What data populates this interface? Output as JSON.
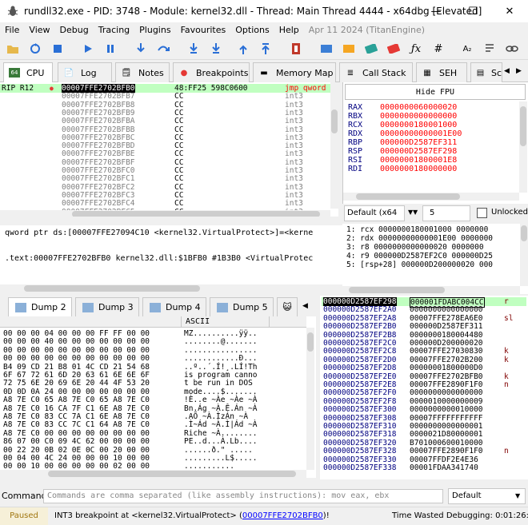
{
  "window": {
    "title": "rundll32.exe - PID: 3748 - Module: kernel32.dll - Thread: Main Thread 4444 - x64dbg [Elevated]",
    "minimize": "—",
    "maximize": "☐",
    "close": "✕"
  },
  "menu": {
    "items": [
      "File",
      "View",
      "Debug",
      "Tracing",
      "Plugins",
      "Favourites",
      "Options",
      "Help"
    ],
    "date": "Apr 11 2024 (TitanEngine)"
  },
  "tabs": [
    "CPU",
    "Log",
    "Notes",
    "Breakpoints",
    "Memory Map",
    "Call Stack",
    "SEH",
    "Sc"
  ],
  "disasm": {
    "rip_label": "RIP R12",
    "rows": [
      {
        "addr": "00007FFE2702BFB0",
        "bytes": "48:FF25 598C0600",
        "instr": "jmp qword"
      },
      {
        "addr": "00007FFE2702BFB7",
        "bytes": "CC",
        "instr": "int3"
      },
      {
        "addr": "00007FFE2702BFB8",
        "bytes": "CC",
        "instr": "int3"
      },
      {
        "addr": "00007FFE2702BFB9",
        "bytes": "CC",
        "instr": "int3"
      },
      {
        "addr": "00007FFE2702BFBA",
        "bytes": "CC",
        "instr": "int3"
      },
      {
        "addr": "00007FFE2702BFBB",
        "bytes": "CC",
        "instr": "int3"
      },
      {
        "addr": "00007FFE2702BFBC",
        "bytes": "CC",
        "instr": "int3"
      },
      {
        "addr": "00007FFE2702BFBD",
        "bytes": "CC",
        "instr": "int3"
      },
      {
        "addr": "00007FFE2702BFBE",
        "bytes": "CC",
        "instr": "int3"
      },
      {
        "addr": "00007FFE2702BFBF",
        "bytes": "CC",
        "instr": "int3"
      },
      {
        "addr": "00007FFE2702BFC0",
        "bytes": "CC",
        "instr": "int3"
      },
      {
        "addr": "00007FFE2702BFC1",
        "bytes": "CC",
        "instr": "int3"
      },
      {
        "addr": "00007FFE2702BFC2",
        "bytes": "CC",
        "instr": "int3"
      },
      {
        "addr": "00007FFE2702BFC3",
        "bytes": "CC",
        "instr": "int3"
      },
      {
        "addr": "00007FFE2702BFC4",
        "bytes": "CC",
        "instr": "int3"
      },
      {
        "addr": "00007FFE2702BFC5",
        "bytes": "CC",
        "instr": "int3"
      }
    ]
  },
  "info": {
    "line1": "qword ptr ds:[00007FFE27094C10 <kernel32.VirtualProtect>]=<kerne",
    "line2": ".text:00007FFE2702BFB0 kernel32.dll:$1BFB0 #1B3B0 <VirtualProtec"
  },
  "registers": {
    "hide_fpu": "Hide FPU",
    "rows": [
      {
        "name": "RAX",
        "value": "0000000060000020"
      },
      {
        "name": "RBX",
        "value": "0000000000000000"
      },
      {
        "name": "RCX",
        "value": "0000000180001000"
      },
      {
        "name": "RDX",
        "value": "00000000000001E00"
      },
      {
        "name": "RBP",
        "value": "000000D2587EF311"
      },
      {
        "name": "RSP",
        "value": "000000D2587EF298"
      },
      {
        "name": "RSI",
        "value": "00000001800001E8"
      },
      {
        "name": "RDI",
        "value": "0000000180000000"
      }
    ]
  },
  "callconv": {
    "convention": "Default (x64",
    "arg_count": "5",
    "unlocked": "Unlocked"
  },
  "stack_args": [
    "1: rcx 0000000180001000 0000000",
    "2: rdx 00000000000001E00 0000000",
    "3: r8 0000000000000020 0000000",
    "4: r9 000000D2587EF2C0 000000D25",
    "5: [rsp+28] 000000D200000020 000"
  ],
  "dump_tabs": [
    "Dump 2",
    "Dump 3",
    "Dump 4",
    "Dump 5"
  ],
  "dump": {
    "ascii_header": "ASCII",
    "rows": [
      {
        "hex": "00 00 00 04 00 00 00 FF FF 00 00",
        "ascii": "MZ..........ÿÿ.."
      },
      {
        "hex": "00 00 00 40 00 00 00 00 00 00 00",
        "ascii": "........@......."
      },
      {
        "hex": "00 00 00 00 00 00 00 00 00 00 00",
        "ascii": "................"
      },
      {
        "hex": "00 00 00 00 00 00 00 00 00 00 00",
        "ascii": "............Ð..."
      },
      {
        "hex": "B4 09 CD 21 B8 01 4C CD 21 54 68",
        "ascii": "..º..´.Í!¸.LÍ!Th"
      },
      {
        "hex": "6F 67 72 61 6D 20 63 61 6E 6E 6F",
        "ascii": "is program canno"
      },
      {
        "hex": "72 75 6E 20 69 6E 20 44 4F 53 20",
        "ascii": "t be run in DOS "
      },
      {
        "hex": "0D 0D 0A 24 00 00 00 00 00 00 00",
        "ascii": "mode....$......."
      },
      {
        "hex": "A8 7E C0 65 A8 7E C0 65 A8 7E C0",
        "ascii": "!È..e ~Àe ~Àe ~À"
      },
      {
        "hex": "A8 7E C0 16 CA 7F C1 6E A8 7E C0",
        "ascii": "Bn.Ág ~À.Ê.Án ~À"
      },
      {
        "hex": "A8 7E C0 83 CC 7A C1 6E A8 7E C0",
        "ascii": ".AÕ ~À.ÌzÁn ~À"
      },
      {
        "hex": "A8 7E C0 83 CC 7C C1 64 A8 7E C0",
        "ascii": ".Ì~Ád ~À.Ì|Ád ~À"
      },
      {
        "hex": "A8 7E C0 00 00 00 00 00 00 00 00",
        "ascii": "Riche ~À........"
      },
      {
        "hex": "86 07 00 C0 09 4C 62 00 00 00 00",
        "ascii": "PE..d...À.Lb...."
      },
      {
        "hex": "00 22 20 0B 02 0E 0C 00 20 00 00",
        "ascii": "......ð.\" ..... "
      },
      {
        "hex": "00 04 00 4C 24 00 00 00 10 00 00",
        "ascii": ".........L$....."
      },
      {
        "hex": "00 00 10 00 00 00 00 00 02 00 00",
        "ascii": "..........."
      }
    ]
  },
  "stack": {
    "rows": [
      {
        "addr": "000000D2587EF298",
        "value": "000001FDABC004CC",
        "comment": "r"
      },
      {
        "addr": "000000D2587EF2A0",
        "value": "0000000000000000",
        "comment": ""
      },
      {
        "addr": "000000D2587EF2A8",
        "value": "00007FFE278EA6E0",
        "comment": "sl"
      },
      {
        "addr": "000000D2587EF2B0",
        "value": "000000D2587EF311",
        "comment": ""
      },
      {
        "addr": "000000D2587EF2B8",
        "value": "0000000180004480",
        "comment": ""
      },
      {
        "addr": "000000D2587EF2C0",
        "value": "000000D200000020",
        "comment": ""
      },
      {
        "addr": "000000D2587EF2C8",
        "value": "00007FFE27030830",
        "comment": "k"
      },
      {
        "addr": "000000D2587EF2D0",
        "value": "00007FFE2702B200",
        "comment": "k"
      },
      {
        "addr": "000000D2587EF2D8",
        "value": "00000001800000D0",
        "comment": ""
      },
      {
        "addr": "000000D2587EF2E0",
        "value": "00007FFE2702BFB0",
        "comment": "k"
      },
      {
        "addr": "000000D2587EF2E8",
        "value": "00007FFE2890F1F0",
        "comment": "n"
      },
      {
        "addr": "000000D2587EF2F0",
        "value": "0000000000000000",
        "comment": ""
      },
      {
        "addr": "000000D2587EF2F8",
        "value": "0000010000000009",
        "comment": ""
      },
      {
        "addr": "000000D2587EF300",
        "value": "0000000000010000",
        "comment": ""
      },
      {
        "addr": "000000D2587EF308",
        "value": "00007FFFFFFFFFFF",
        "comment": ""
      },
      {
        "addr": "000000D2587EF310",
        "value": "0000000000000001",
        "comment": ""
      },
      {
        "addr": "000000D2587EF318",
        "value": "0000021D80000001",
        "comment": ""
      },
      {
        "addr": "000000D2587EF320",
        "value": "B701000600010000",
        "comment": ""
      },
      {
        "addr": "000000D2587EF328",
        "value": "00007FFE2890F1F0",
        "comment": "n"
      },
      {
        "addr": "000000D2587EF330",
        "value": "00007FFDF2E4E36",
        "comment": ""
      },
      {
        "addr": "000000D2587EF338",
        "value": "00001FDAA341740",
        "comment": ""
      }
    ]
  },
  "command": {
    "label": "Command:",
    "placeholder": "Commands are comma separated (like assembly instructions): mov eax, ebx",
    "mode": "Default"
  },
  "status": {
    "state": "Paused",
    "message": "INT3 breakpoint at <kernel32.VirtualProtect> (",
    "link": "00007FFE2702BFB0",
    "suffix": ")!",
    "time": "Time Wasted Debugging: 0:01:26:41"
  }
}
